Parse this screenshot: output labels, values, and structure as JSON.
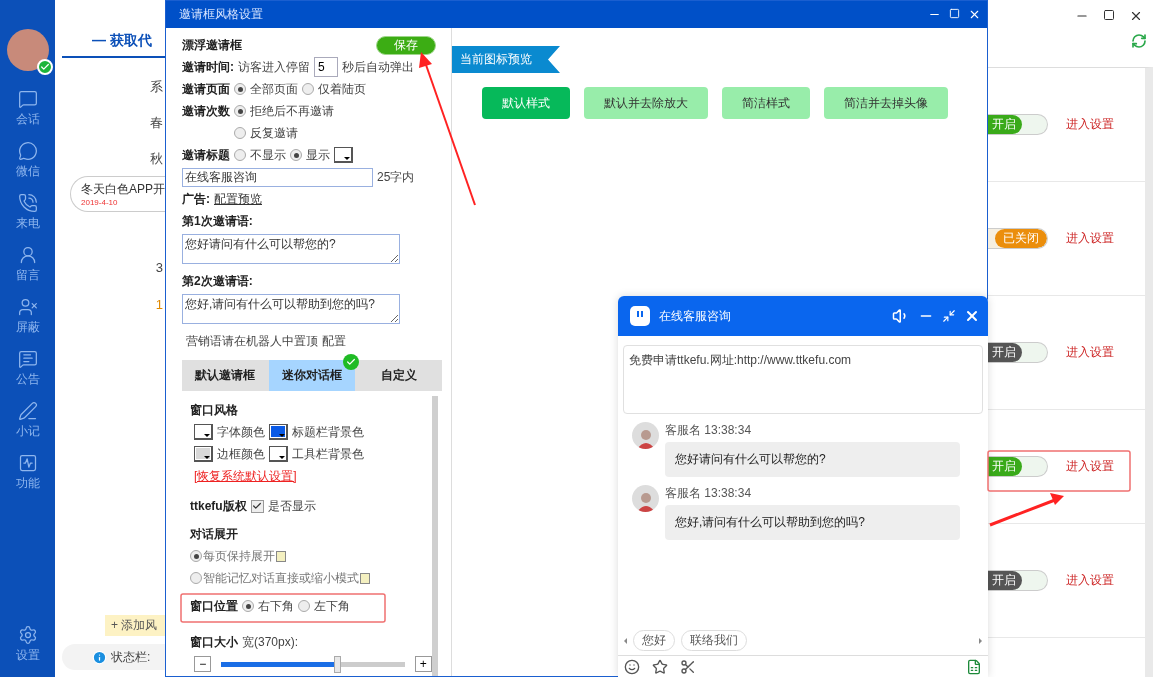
{
  "app": {
    "sidebar": [
      "会话",
      "微信",
      "来电",
      "留言",
      "屏蔽",
      "公告",
      "小记",
      "功能"
    ],
    "settings_label": "设置",
    "header_tab": "— 获取代",
    "fragments": [
      "系",
      "春",
      "秋"
    ],
    "pill": {
      "text": "冬天白色APP开",
      "date": "2019-4-10"
    },
    "numbers": [
      {
        "text": "3",
        "kind": "plain"
      },
      {
        "text": "1",
        "kind": "accent"
      }
    ],
    "add_button": "+ 添加风",
    "status_bar": "状态栏:",
    "rows": [
      {
        "on": true,
        "disabled": false,
        "toggle": "开启",
        "link": "进入设置"
      },
      {
        "on": false,
        "disabled": false,
        "toggle": "已关闭",
        "link": "进入设置"
      },
      {
        "on": true,
        "disabled": true,
        "toggle": "开启",
        "link": "进入设置"
      },
      {
        "on": true,
        "disabled": false,
        "toggle": "开启",
        "link": "进入设置"
      },
      {
        "on": true,
        "disabled": true,
        "toggle": "开启",
        "link": "进入设置"
      }
    ]
  },
  "dialog": {
    "title": "邀请框风格设置",
    "section_title": "漂浮邀请框",
    "save_button": "保存",
    "invite_time": {
      "label": "邀请时间:",
      "prefix": "访客进入停留",
      "value": "5",
      "suffix": "秒后自动弹出"
    },
    "invite_page": {
      "label": "邀请页面",
      "options": [
        {
          "label": "全部页面",
          "selected": true
        },
        {
          "label": "仅着陆页",
          "selected": false
        }
      ]
    },
    "invite_count": {
      "label": "邀请次数",
      "options": [
        {
          "label": "拒绝后不再邀请",
          "selected": true
        },
        {
          "label": "反复邀请",
          "selected": false
        }
      ]
    },
    "invite_title": {
      "label": "邀请标题",
      "options": [
        {
          "label": "不显示",
          "selected": false
        },
        {
          "label": "显示",
          "selected": true
        }
      ],
      "value": "在线客服咨询",
      "hint": "25字内"
    },
    "ad": {
      "label": "广告:",
      "link": "配置预览"
    },
    "messages": [
      {
        "label": "第1次邀请语:",
        "value": "您好请问有什么可以帮您的?"
      },
      {
        "label": "第2次邀请语:",
        "value": "您好,请问有什么可以帮助到您的吗?"
      }
    ],
    "marketing": {
      "note": "营销语请在机器人中置顶",
      "link": "配置"
    },
    "style_tabs": [
      {
        "label": "默认邀请框",
        "selected": false
      },
      {
        "label": "迷你对话框",
        "selected": true
      },
      {
        "label": "自定义",
        "selected": false
      }
    ],
    "window_style": {
      "title": "窗口风格",
      "colors": [
        {
          "label": "字体颜色",
          "color": "#ffffff"
        },
        {
          "label": "标题栏背景色",
          "color": "#0a5ae6"
        },
        {
          "label": "边框颜色",
          "color": "#d8d8d8"
        },
        {
          "label": "工具栏背景色",
          "color": "#ffffff"
        }
      ],
      "reset_link": "[恢复系统默认设置]"
    },
    "copyright": {
      "label": "ttkefu版权",
      "checkbox_label": "是否显示",
      "checked": true
    },
    "expand": {
      "title": "对话展开",
      "options": [
        {
          "label": "每页保持展开",
          "selected": true
        },
        {
          "label": "智能记忆对话直接或缩小模式",
          "selected": false
        }
      ]
    },
    "position": {
      "label": "窗口位置",
      "options": [
        {
          "label": "右下角",
          "selected": true
        },
        {
          "label": "左下角",
          "selected": false
        }
      ]
    },
    "size": {
      "label": "窗口大小",
      "width_label": "宽(370px):",
      "minus": "−",
      "plus": "+",
      "level": 0.63
    },
    "preview_label": "当前图标预览",
    "preview_styles": [
      {
        "label": "默认样式",
        "selected": true
      },
      {
        "label": "默认并去除放大",
        "selected": false
      },
      {
        "label": "简洁样式",
        "selected": false
      },
      {
        "label": "简洁并去掉头像",
        "selected": false
      }
    ]
  },
  "chat": {
    "title": "在线客服咨询",
    "notice": "免费申请ttkefu.网址:http://www.ttkefu.com",
    "messages": [
      {
        "name": "客服名",
        "time": "13:38:34",
        "text": "您好请问有什么可以帮您的?"
      },
      {
        "name": "客服名",
        "time": "13:38:34",
        "text": "您好,请问有什么可以帮助到您的吗?"
      }
    ],
    "quick_replies": [
      "您好",
      "联络我们"
    ]
  }
}
